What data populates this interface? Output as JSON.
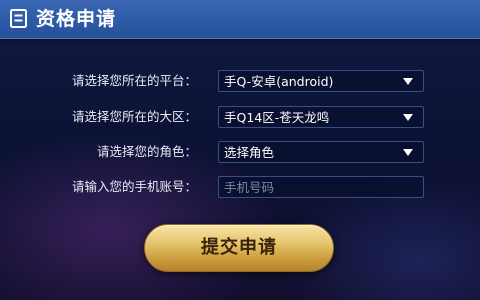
{
  "header": {
    "title": "资格申请",
    "icon": "list-icon"
  },
  "form": {
    "platform": {
      "label": "请选择您所在的平台：",
      "value": "手Q-安卓(android)"
    },
    "region": {
      "label": "请选择您所在的大区：",
      "value": "手Q14区-苍天龙鸣"
    },
    "role": {
      "label": "请选择您的角色：",
      "value": "选择角色"
    },
    "phone": {
      "label": "请输入您的手机账号：",
      "placeholder": "手机号码",
      "value": ""
    },
    "submit_label": "提交申请"
  },
  "colors": {
    "header": "#2c5aa6",
    "button_gold": "#e5c56d",
    "field_border": "#3b4d86"
  }
}
